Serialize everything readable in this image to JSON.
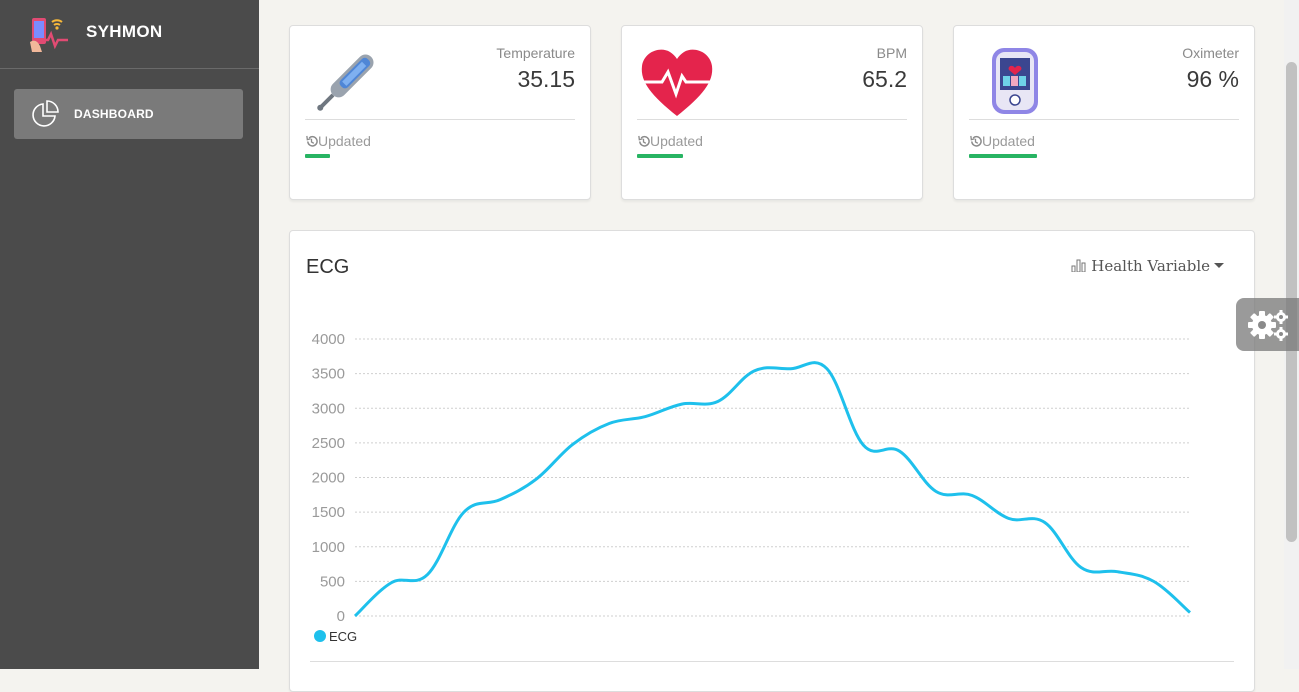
{
  "sidebar": {
    "brand": "SYHMON",
    "nav": [
      {
        "label": "DASHBOARD",
        "icon": "pie-chart-icon",
        "active": true
      }
    ]
  },
  "cards": {
    "temperature": {
      "title": "Temperature",
      "value": "35.15",
      "footer": "Updated",
      "icon": "thermometer-icon"
    },
    "bpm": {
      "title": "BPM",
      "value": "65.2",
      "footer": "Updated",
      "icon": "heart-pulse-icon"
    },
    "oximeter": {
      "title": "Oximeter",
      "value": "96 %",
      "footer": "Updated",
      "icon": "pulse-oximeter-icon"
    }
  },
  "colors": {
    "sidebar": "#4b4b4b",
    "nav_active": "#7a7a7a",
    "status_green": "#28b463",
    "series_line": "#1ec0ec"
  },
  "ecg": {
    "title": "ECG",
    "dropdown_label": "Health Variable"
  },
  "chart_data": {
    "type": "line",
    "title": "ECG",
    "x": [
      0,
      1,
      2,
      3,
      4,
      5,
      6,
      7,
      8,
      9,
      10,
      11,
      12,
      13,
      14,
      15,
      16,
      17,
      18,
      19,
      20,
      21,
      22,
      23
    ],
    "series": [
      {
        "name": "ECG",
        "values": [
          0,
          480,
          600,
          1500,
          1680,
          1980,
          2480,
          2780,
          2880,
          3060,
          3100,
          3540,
          3570,
          3570,
          2470,
          2380,
          1800,
          1740,
          1410,
          1350,
          700,
          640,
          500,
          50
        ]
      }
    ],
    "ylim": [
      0,
      4000
    ],
    "yticks": [
      "4000",
      "3500",
      "3000",
      "2500",
      "2000",
      "1500",
      "1000",
      "500",
      "0"
    ],
    "grid": true,
    "legend": "bottom-left"
  }
}
